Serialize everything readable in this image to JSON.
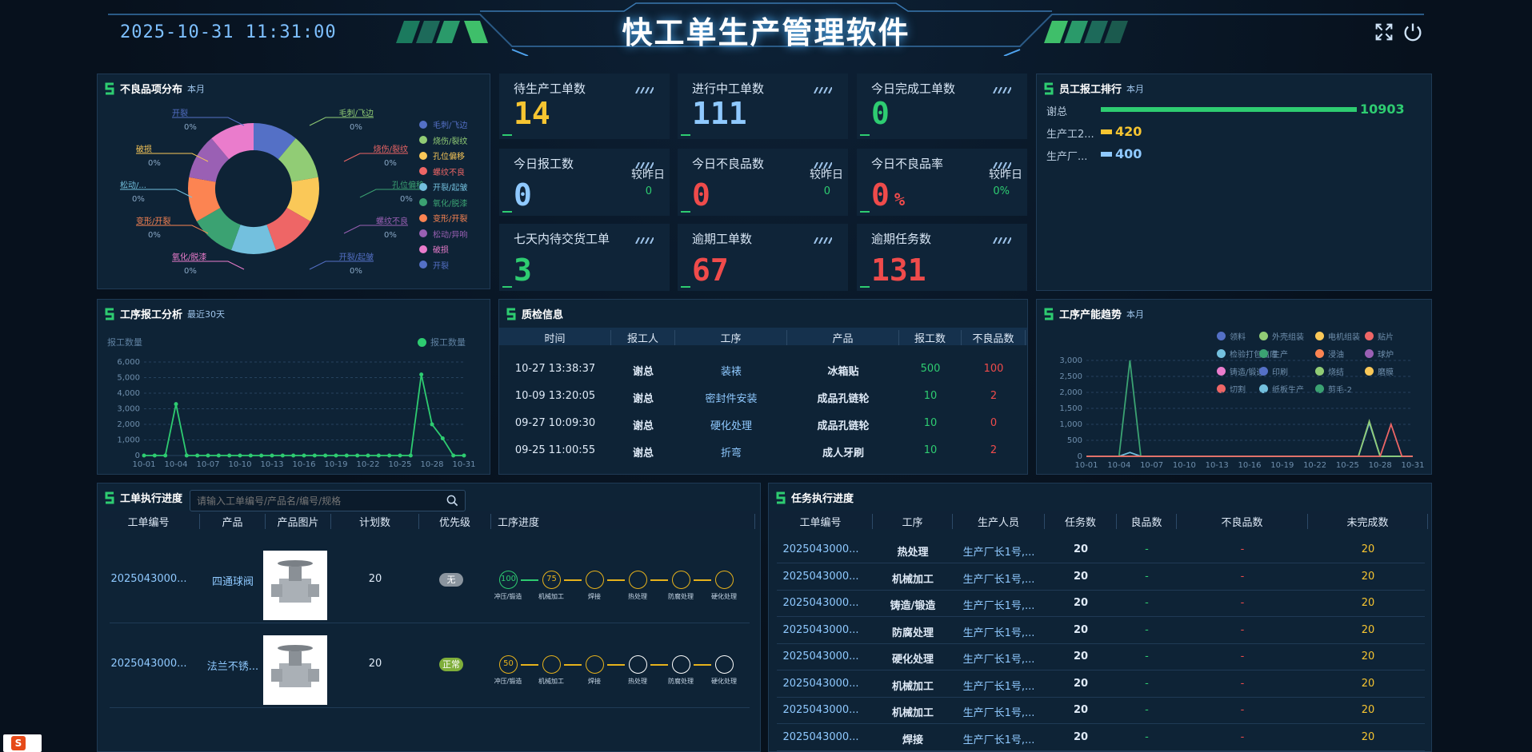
{
  "header": {
    "datetime": "2025-10-31  11:31:00",
    "title": "快工单生产管理软件",
    "fullscreen_icon": "fullscreen-icon",
    "power_icon": "power-icon"
  },
  "defects": {
    "title": "不良品项分布",
    "period": "本月",
    "labels": [
      {
        "name": "开裂",
        "pct": "0%"
      },
      {
        "name": "毛刺/飞边",
        "pct": "0%"
      },
      {
        "name": "破损",
        "pct": "0%"
      },
      {
        "name": "烧伤/裂纹",
        "pct": "0%"
      },
      {
        "name": "松动/...",
        "pct": "0%"
      },
      {
        "name": "孔位偏移",
        "pct": "0%"
      },
      {
        "name": "变形/开裂",
        "pct": "0%"
      },
      {
        "name": "螺纹不良",
        "pct": "0%"
      },
      {
        "name": "氧化/脱漆",
        "pct": "0%"
      },
      {
        "name": "开裂/起皱",
        "pct": "0%"
      }
    ],
    "legend": [
      {
        "name": "毛刺/飞边",
        "color": "#5470c6"
      },
      {
        "name": "烧伤/裂纹",
        "color": "#91cc75"
      },
      {
        "name": "孔位偏移",
        "color": "#fac858"
      },
      {
        "name": "螺纹不良",
        "color": "#ee6666"
      },
      {
        "name": "开裂/起皱",
        "color": "#73c0de"
      },
      {
        "name": "氧化/脱漆",
        "color": "#3ba272"
      },
      {
        "name": "变形/开裂",
        "color": "#fc8452"
      },
      {
        "name": "松动/异响",
        "color": "#9a60b4"
      },
      {
        "name": "破损",
        "color": "#ea7ccc"
      },
      {
        "name": "开裂",
        "color": "#5470c6"
      }
    ]
  },
  "stats": [
    {
      "label": "待生产工单数",
      "value": "14",
      "color": "#f7c531"
    },
    {
      "label": "进行中工单数",
      "value": "111",
      "color": "#8fc9ff"
    },
    {
      "label": "今日完成工单数",
      "value": "0",
      "color": "#2ecc71"
    },
    {
      "label": "今日报工数",
      "value": "0",
      "color": "#8fc9ff",
      "cmp": "较昨日",
      "cmpv": "0"
    },
    {
      "label": "今日不良品数",
      "value": "0",
      "color": "#ef4b4b",
      "cmp": "较昨日",
      "cmpv": "0"
    },
    {
      "label": "今日不良品率",
      "value": "0",
      "unit": "%",
      "color": "#ef4b4b",
      "cmp": "较昨日",
      "cmpv": "0%"
    },
    {
      "label": "七天内待交货工单",
      "value": "3",
      "color": "#2ecc71"
    },
    {
      "label": "逾期工单数",
      "value": "67",
      "color": "#ef4b4b"
    },
    {
      "label": "逾期任务数",
      "value": "131",
      "color": "#ef4b4b"
    }
  ],
  "ranking": {
    "title": "员工报工排行",
    "period": "本月",
    "rows": [
      {
        "name": "谢总",
        "value": "10903",
        "color": "#2ecc71",
        "frac": 1.0
      },
      {
        "name": "生产工2...",
        "value": "420",
        "color": "#f7c531",
        "frac": 0.0385
      },
      {
        "name": "生产厂...",
        "value": "400",
        "color": "#8fc9ff",
        "frac": 0.0367
      }
    ]
  },
  "process_report": {
    "title": "工序报工分析",
    "period": "最近30天",
    "ylabel": "报工数量",
    "legend": "报工数量"
  },
  "chart_data": [
    {
      "type": "line",
      "title": "工序报工分析",
      "ylabel": "报工数量",
      "x": [
        "10-01",
        "10-02",
        "10-03",
        "10-04",
        "10-05",
        "10-06",
        "10-07",
        "10-08",
        "10-09",
        "10-10",
        "10-11",
        "10-12",
        "10-13",
        "10-14",
        "10-15",
        "10-16",
        "10-17",
        "10-18",
        "10-19",
        "10-20",
        "10-21",
        "10-22",
        "10-23",
        "10-24",
        "10-25",
        "10-26",
        "10-27",
        "10-28",
        "10-29",
        "10-30",
        "10-31"
      ],
      "xticks": [
        "10-01",
        "10-04",
        "10-07",
        "10-10",
        "10-13",
        "10-16",
        "10-19",
        "10-22",
        "10-25",
        "10-28",
        "10-31"
      ],
      "yticks": [
        "0",
        "1,000",
        "2,000",
        "3,000",
        "4,000",
        "5,000",
        "6,000"
      ],
      "ylim": [
        0,
        6000
      ],
      "series": [
        {
          "name": "报工数量",
          "color": "#2ecc71",
          "values": [
            0,
            0,
            0,
            3300,
            0,
            0,
            0,
            0,
            0,
            0,
            0,
            0,
            0,
            0,
            0,
            0,
            0,
            0,
            0,
            0,
            0,
            0,
            0,
            0,
            0,
            0,
            5200,
            2000,
            1100,
            0,
            0
          ]
        }
      ]
    },
    {
      "type": "line",
      "title": "工序产能趋势",
      "x": [
        "10-01",
        "10-02",
        "10-03",
        "10-04",
        "10-05",
        "10-06",
        "10-07",
        "10-08",
        "10-09",
        "10-10",
        "10-11",
        "10-12",
        "10-13",
        "10-14",
        "10-15",
        "10-16",
        "10-17",
        "10-18",
        "10-19",
        "10-20",
        "10-21",
        "10-22",
        "10-23",
        "10-24",
        "10-25",
        "10-26",
        "10-27",
        "10-28",
        "10-29",
        "10-30",
        "10-31"
      ],
      "xticks": [
        "10-01",
        "10-04",
        "10-07",
        "10-10",
        "10-13",
        "10-16",
        "10-19",
        "10-22",
        "10-25",
        "10-28",
        "10-31"
      ],
      "yticks": [
        "0",
        "500",
        "1,000",
        "1,500",
        "2,000",
        "2,500",
        "3,000"
      ],
      "ylim": [
        0,
        3000
      ],
      "series": [
        {
          "name": "生产",
          "color": "#3ba272",
          "values": [
            0,
            0,
            0,
            0,
            3000,
            0,
            0,
            0,
            0,
            0,
            0,
            0,
            0,
            0,
            0,
            0,
            0,
            0,
            0,
            0,
            0,
            0,
            0,
            0,
            0,
            0,
            0,
            0,
            0,
            0,
            0
          ]
        },
        {
          "name": "检验打包出库",
          "color": "#73c0de",
          "values": [
            0,
            0,
            0,
            0,
            120,
            0,
            0,
            0,
            0,
            0,
            0,
            0,
            0,
            0,
            0,
            0,
            0,
            0,
            0,
            0,
            0,
            0,
            0,
            0,
            0,
            0,
            1050,
            0,
            0,
            0,
            0
          ]
        },
        {
          "name": "外壳组装",
          "color": "#91cc75",
          "values": [
            0,
            0,
            0,
            0,
            0,
            0,
            0,
            0,
            0,
            0,
            0,
            0,
            0,
            0,
            0,
            0,
            0,
            0,
            0,
            0,
            0,
            0,
            0,
            0,
            0,
            0,
            1100,
            0,
            0,
            0,
            0
          ]
        },
        {
          "name": "贴片",
          "color": "#ee6666",
          "values": [
            0,
            0,
            0,
            0,
            0,
            0,
            0,
            0,
            0,
            0,
            0,
            0,
            0,
            0,
            0,
            0,
            0,
            0,
            0,
            0,
            0,
            0,
            0,
            0,
            0,
            0,
            0,
            0,
            1000,
            0,
            0
          ]
        }
      ]
    }
  ],
  "capacity": {
    "title": "工序产能趋势",
    "period": "本月",
    "legend": [
      {
        "name": "领料",
        "color": "#5470c6"
      },
      {
        "name": "外壳组装",
        "color": "#91cc75"
      },
      {
        "name": "电机组装",
        "color": "#fac858"
      },
      {
        "name": "贴片",
        "color": "#ee6666"
      },
      {
        "name": "检验打包出库",
        "color": "#73c0de"
      },
      {
        "name": "生产",
        "color": "#3ba272"
      },
      {
        "name": "浸油",
        "color": "#fc8452"
      },
      {
        "name": "球炉",
        "color": "#9a60b4"
      },
      {
        "name": "铸造/锻造",
        "color": "#ea7ccc"
      },
      {
        "name": "印刷",
        "color": "#5470c6"
      },
      {
        "name": "烧结",
        "color": "#91cc75"
      },
      {
        "name": "磨膜",
        "color": "#fac858"
      },
      {
        "name": "切割",
        "color": "#ee6666"
      },
      {
        "name": "纸板生产",
        "color": "#73c0de"
      },
      {
        "name": "剪毛-2",
        "color": "#3ba272"
      }
    ]
  },
  "quality": {
    "title": "质检信息",
    "headers": [
      "时间",
      "报工人",
      "工序",
      "产品",
      "报工数",
      "不良品数"
    ],
    "rows": [
      {
        "time": "10-27 13:38:37",
        "worker": "谢总",
        "process": "装裱",
        "product": "冰箱贴",
        "qty": "500",
        "bad": "100"
      },
      {
        "time": "10-09 13:20:05",
        "worker": "谢总",
        "process": "密封件安装",
        "product": "成品孔链轮",
        "qty": "10",
        "bad": "2"
      },
      {
        "time": "09-27 10:09:30",
        "worker": "谢总",
        "process": "硬化处理",
        "product": "成品孔链轮",
        "qty": "10",
        "bad": "0"
      },
      {
        "time": "09-25 11:00:55",
        "worker": "谢总",
        "process": "折弯",
        "product": "成人牙刷",
        "qty": "10",
        "bad": "2"
      }
    ]
  },
  "orders": {
    "title": "工单执行进度",
    "search_placeholder": "请输入工单编号/产品名/编号/规格",
    "headers": [
      "工单编号",
      "产品",
      "产品图片",
      "计划数",
      "优先级",
      "工序进度"
    ],
    "rows": [
      {
        "code": "2025043000...",
        "product": "四通球阀",
        "plan": "20",
        "priority": "无",
        "priority_color": "#8a949e",
        "steps": [
          {
            "v": "100",
            "c": "green"
          },
          {
            "v": "75",
            "c": "yellow"
          },
          {
            "v": "",
            "c": "yellow"
          },
          {
            "v": "",
            "c": "yellow"
          },
          {
            "v": "",
            "c": "yellow"
          },
          {
            "v": "",
            "c": "yellow"
          }
        ]
      },
      {
        "code": "2025043000...",
        "product": "法兰不锈...",
        "plan": "20",
        "priority": "正常",
        "priority_color": "#7fae3a",
        "steps": [
          {
            "v": "50",
            "c": "yellow"
          },
          {
            "v": "",
            "c": "yellow"
          },
          {
            "v": "",
            "c": "yellow"
          },
          {
            "v": "",
            "c": "white"
          },
          {
            "v": "",
            "c": "white"
          },
          {
            "v": "",
            "c": "white"
          }
        ]
      }
    ],
    "step_names": [
      "冲压/锻造",
      "机械加工",
      "焊接",
      "热处理",
      "防腐处理",
      "硬化处理"
    ]
  },
  "tasks": {
    "title": "任务执行进度",
    "headers": [
      "工单编号",
      "工序",
      "生产人员",
      "任务数",
      "良品数",
      "不良品数",
      "未完成数"
    ],
    "rows": [
      {
        "code": "2025043000...",
        "process": "热处理",
        "person": "生产厂长1号,...",
        "count": "20",
        "good": "-",
        "bad": "-",
        "left": "20"
      },
      {
        "code": "2025043000...",
        "process": "机械加工",
        "person": "生产厂长1号,...",
        "count": "20",
        "good": "-",
        "bad": "-",
        "left": "20"
      },
      {
        "code": "2025043000...",
        "process": "铸造/锻造",
        "person": "生产厂长1号,...",
        "count": "20",
        "good": "-",
        "bad": "-",
        "left": "20"
      },
      {
        "code": "2025043000...",
        "process": "防腐处理",
        "person": "生产厂长1号,...",
        "count": "20",
        "good": "-",
        "bad": "-",
        "left": "20"
      },
      {
        "code": "2025043000...",
        "process": "硬化处理",
        "person": "生产厂长1号,...",
        "count": "20",
        "good": "-",
        "bad": "-",
        "left": "20"
      },
      {
        "code": "2025043000...",
        "process": "机械加工",
        "person": "生产厂长1号,...",
        "count": "20",
        "good": "-",
        "bad": "-",
        "left": "20"
      },
      {
        "code": "2025043000...",
        "process": "机械加工",
        "person": "生产厂长1号,...",
        "count": "20",
        "good": "-",
        "bad": "-",
        "left": "20"
      },
      {
        "code": "2025043000...",
        "process": "焊接",
        "person": "生产厂长1号,...",
        "count": "20",
        "good": "-",
        "bad": "-",
        "left": "20"
      }
    ]
  },
  "colors": {
    "accent": "#2ecc71",
    "panel": "#0e2336",
    "header_bg": "#15314d"
  }
}
